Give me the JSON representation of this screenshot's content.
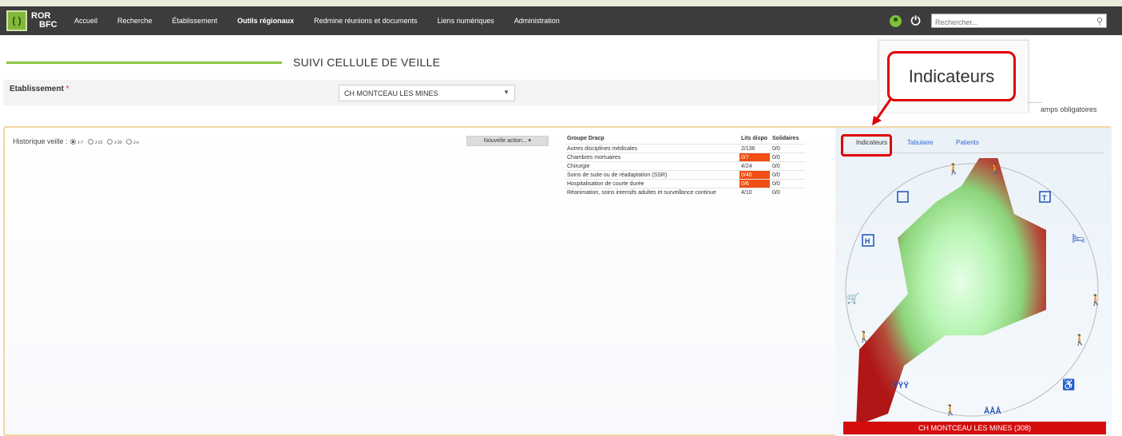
{
  "app": {
    "logo_line1": "ROR",
    "logo_line2": "BFC"
  },
  "nav": {
    "items": [
      {
        "label": "Accueil"
      },
      {
        "label": "Recherche"
      },
      {
        "label": "Établissement"
      },
      {
        "label": "Outils régionaux",
        "active": true
      },
      {
        "label": "Redmine réunions et documents"
      },
      {
        "label": "Liens numériques"
      },
      {
        "label": "Administration"
      }
    ],
    "search_placeholder": "Rechercher..."
  },
  "page": {
    "title": "SUIVI CELLULE DE VEILLE",
    "etablissement_label": "Etablissement",
    "required_mark": "*",
    "etablissement_value": "CH MONTCEAU LES MINES",
    "champs_obligatoires": "amps obligatoires"
  },
  "callout": {
    "label": "Indicateurs"
  },
  "veille": {
    "historique_label": "Historique veille :",
    "options": [
      "J-7",
      "J-15",
      "J-30",
      "J-n"
    ],
    "selected_option": 0,
    "action_button": "Nouvelle action...",
    "table": {
      "headers": [
        "Groupe Dracp",
        "Lits dispo",
        "Solidaires"
      ],
      "rows": [
        {
          "groupe": "Autres disciplines médicales",
          "lits": "2/136",
          "solidaires": "0/0",
          "alert": false
        },
        {
          "groupe": "Chambres mortuaires",
          "lits": "0/7",
          "solidaires": "0/0",
          "alert": true
        },
        {
          "groupe": "Chirurgie",
          "lits": "4/24",
          "solidaires": "0/0",
          "alert": false
        },
        {
          "groupe": "Soins de suite ou de réadaptation (SSR)",
          "lits": "0/40",
          "solidaires": "0/0",
          "alert": true
        },
        {
          "groupe": "Hospitalisation de courte durée",
          "lits": "0/6",
          "solidaires": "0/0",
          "alert": true
        },
        {
          "groupe": "Réanimation, soins intensifs adultes et surveillance continue",
          "lits": "4/10",
          "solidaires": "0/0",
          "alert": false
        }
      ]
    },
    "tabs": [
      "Indicateurs",
      "Tabulaire",
      "Patients"
    ],
    "footer": "CH MONTCEAU LES MINES (308)"
  },
  "colors": {
    "accent_green": "#8dc63f",
    "alert_orange": "#f04e12",
    "highlight_red": "#e00000",
    "footer_red": "#d40d0d"
  }
}
